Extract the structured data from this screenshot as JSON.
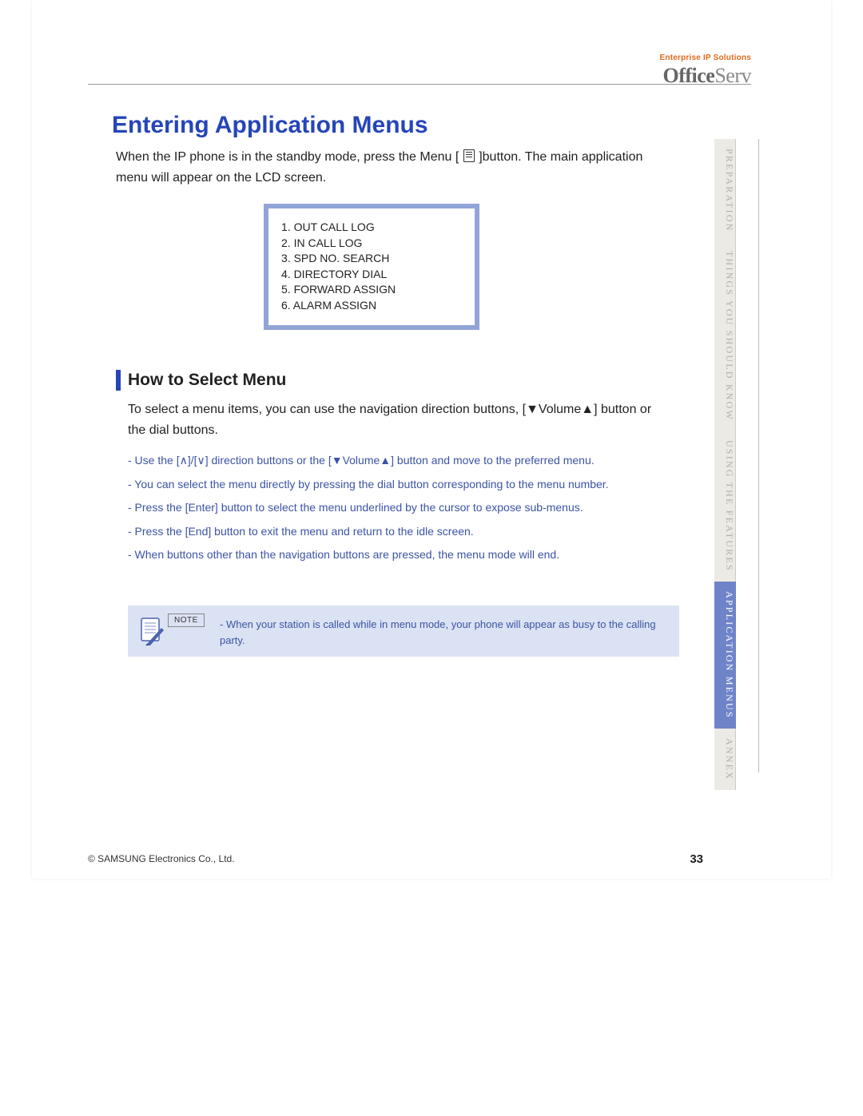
{
  "header": {
    "tagline": "Enterprise IP Solutions",
    "logo_bold": "Office",
    "logo_light": "Serv"
  },
  "title": "Entering Application Menus",
  "intro_a": "When the IP phone is in the standby mode, press the Menu [",
  "intro_b": "]button. The main application menu will appear on the LCD screen.",
  "lcd_items": [
    "1. OUT CALL LOG",
    "2. IN CALL LOG",
    "3. SPD NO. SEARCH",
    "4. DIRECTORY DIAL",
    "5. FORWARD ASSIGN",
    "6. ALARM ASSIGN"
  ],
  "sub_title": "How to Select Menu",
  "sub_intro": "To select a menu items, you can use the navigation direction buttons, [▼Volume▲] button or the dial buttons.",
  "bullets": [
    "- Use the [∧]/[∨] direction buttons or the [▼Volume▲] button and move to the preferred menu.",
    "- You can select the menu directly by pressing the dial button corresponding to the menu number.",
    "- Press the [Enter] button to select the menu underlined by the cursor to expose sub-menus.",
    "- Press the [End] button to exit the menu and return to the idle screen.",
    "- When buttons other than the navigation buttons are pressed, the menu mode will end."
  ],
  "note": {
    "label": "NOTE",
    "text": "- When your station is called while in menu mode, your phone will appear as busy to the calling party."
  },
  "footer": {
    "copyright": "© SAMSUNG Electronics Co., Ltd.",
    "page": "33"
  },
  "tabs": [
    {
      "label": "Preparation",
      "active": false
    },
    {
      "label": "Things You Should Know",
      "active": false
    },
    {
      "label": "Using the Features",
      "active": false
    },
    {
      "label": "Application Menus",
      "active": true
    },
    {
      "label": "Annex",
      "active": false
    }
  ]
}
